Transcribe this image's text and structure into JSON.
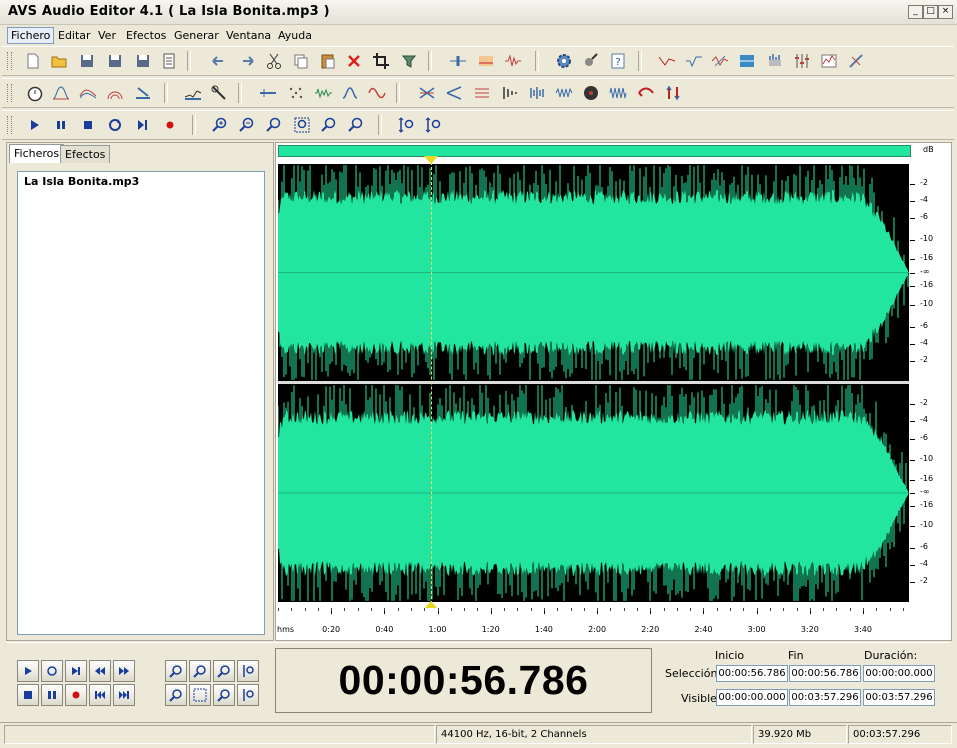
{
  "window": {
    "title": "AVS Audio Editor 4.1  ( La Isla Bonita.mp3 )",
    "controls": [
      "_",
      "□",
      "×"
    ]
  },
  "menu": [
    "Fichero",
    "Editar",
    "Ver",
    "Efectos",
    "Generar",
    "Ventana",
    "Ayuda"
  ],
  "panel": {
    "tabs": [
      "Ficheros",
      "Efectos"
    ],
    "files": [
      "La Isla Bonita.mp3"
    ]
  },
  "waveform": {
    "db_label": "dB",
    "db_scale_top": [
      "-2",
      "-4",
      "-6",
      "-10",
      "-16",
      "-∞",
      "-16",
      "-10",
      "-6",
      "-4",
      "-2"
    ],
    "db_scale_bottom": [
      "-2",
      "-4",
      "-6",
      "-10",
      "-16",
      "-∞",
      "-16",
      "-10",
      "-6",
      "-4",
      "-2"
    ],
    "wave_color": "#22e6a0",
    "ruler_unit": "hms",
    "ruler_ticks": [
      "0:20",
      "0:40",
      "1:00",
      "1:20",
      "1:40",
      "2:00",
      "2:20",
      "2:40",
      "3:00",
      "3:20",
      "3:40"
    ],
    "cursor_fraction": 0.2425
  },
  "transport": {
    "time_display": "00:00:56.786",
    "headers": [
      "Inicio",
      "Fin",
      "Duración:"
    ],
    "rows": [
      {
        "label": "Selección",
        "values": [
          "00:00:56.786",
          "00:00:56.786",
          "00:00:00.000"
        ]
      },
      {
        "label": "Visible",
        "values": [
          "00:00:00.000",
          "00:03:57.296",
          "00:03:57.296"
        ]
      }
    ]
  },
  "status": {
    "format": "44100 Hz, 16-bit, 2 Channels",
    "size": "39.920 Mb",
    "duration": "00:03:57.296"
  }
}
